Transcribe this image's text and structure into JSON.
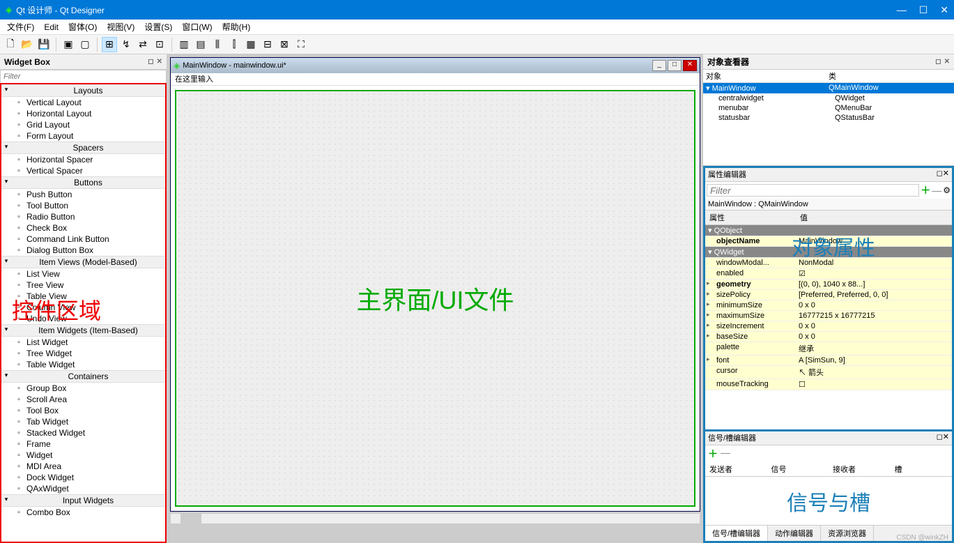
{
  "app": {
    "title": "Qt 设计师 - Qt Designer"
  },
  "menu": {
    "file": "文件(F)",
    "edit": "Edit",
    "window_form": "窗体(O)",
    "view": "视图(V)",
    "settings": "设置(S)",
    "window": "窗口(W)",
    "help": "帮助(H)"
  },
  "widgetbox": {
    "title": "Widget Box",
    "filter_placeholder": "Filter",
    "categories": [
      {
        "name": "Layouts",
        "items": [
          "Vertical Layout",
          "Horizontal Layout",
          "Grid Layout",
          "Form Layout"
        ]
      },
      {
        "name": "Spacers",
        "items": [
          "Horizontal Spacer",
          "Vertical Spacer"
        ]
      },
      {
        "name": "Buttons",
        "items": [
          "Push Button",
          "Tool Button",
          "Radio Button",
          "Check Box",
          "Command Link Button",
          "Dialog Button Box"
        ]
      },
      {
        "name": "Item Views (Model-Based)",
        "items": [
          "List View",
          "Tree View",
          "Table View",
          "Column View",
          "Undo View"
        ]
      },
      {
        "name": "Item Widgets (Item-Based)",
        "items": [
          "List Widget",
          "Tree Widget",
          "Table Widget"
        ]
      },
      {
        "name": "Containers",
        "items": [
          "Group Box",
          "Scroll Area",
          "Tool Box",
          "Tab Widget",
          "Stacked Widget",
          "Frame",
          "Widget",
          "MDI Area",
          "Dock Widget",
          "QAxWidget"
        ]
      },
      {
        "name": "Input Widgets",
        "items": [
          "Combo Box"
        ]
      }
    ]
  },
  "form": {
    "title": "MainWindow - mainwindow.ui*",
    "menu_hint": "在这里输入"
  },
  "objinspector": {
    "title": "对象查看器",
    "col_object": "对象",
    "col_class": "类",
    "rows": [
      {
        "obj": "MainWindow",
        "cls": "QMainWindow",
        "sel": true,
        "indent": 0
      },
      {
        "obj": "centralwidget",
        "cls": "QWidget",
        "sel": false,
        "indent": 1
      },
      {
        "obj": "menubar",
        "cls": "QMenuBar",
        "sel": false,
        "indent": 1
      },
      {
        "obj": "statusbar",
        "cls": "QStatusBar",
        "sel": false,
        "indent": 1
      }
    ]
  },
  "propeditor": {
    "title": "属性编辑器",
    "filter_placeholder": "Filter",
    "classline": "MainWindow : QMainWindow",
    "col_prop": "属性",
    "col_val": "值",
    "sections": [
      {
        "section": "QObject"
      },
      {
        "name": "objectName",
        "val": "MainWindow",
        "bold": true
      },
      {
        "section": "QWidget"
      },
      {
        "name": "windowModal...",
        "val": "NonModal"
      },
      {
        "name": "enabled",
        "val": "☑"
      },
      {
        "name": "geometry",
        "val": "[(0, 0), 1040 x 88...]",
        "bold": true,
        "chev": true
      },
      {
        "name": "sizePolicy",
        "val": "[Preferred, Preferred, 0, 0]",
        "chev": true
      },
      {
        "name": "minimumSize",
        "val": "0 x 0",
        "chev": true
      },
      {
        "name": "maximumSize",
        "val": "16777215 x 16777215",
        "chev": true
      },
      {
        "name": "sizeIncrement",
        "val": "0 x 0",
        "chev": true
      },
      {
        "name": "baseSize",
        "val": "0 x 0",
        "chev": true
      },
      {
        "name": "palette",
        "val": "继承"
      },
      {
        "name": "font",
        "val": "A [SimSun, 9]",
        "chev": true
      },
      {
        "name": "cursor",
        "val": "↖ 箭头"
      },
      {
        "name": "mouseTracking",
        "val": "☐"
      }
    ]
  },
  "sigslot": {
    "title": "信号/槽编辑器",
    "cols": {
      "sender": "发送者",
      "signal": "信号",
      "receiver": "接收者",
      "slot": "槽"
    }
  },
  "tabs": {
    "sigslot": "信号/槽编辑器",
    "action": "动作编辑器",
    "resource": "资源浏览器"
  },
  "annotations": {
    "widgets_area": "控件区域",
    "main_ui": "主界面/UI文件",
    "obj_props": "对象属性",
    "sig_slot": "信号与槽"
  },
  "footer": "CSDN @winkZH"
}
